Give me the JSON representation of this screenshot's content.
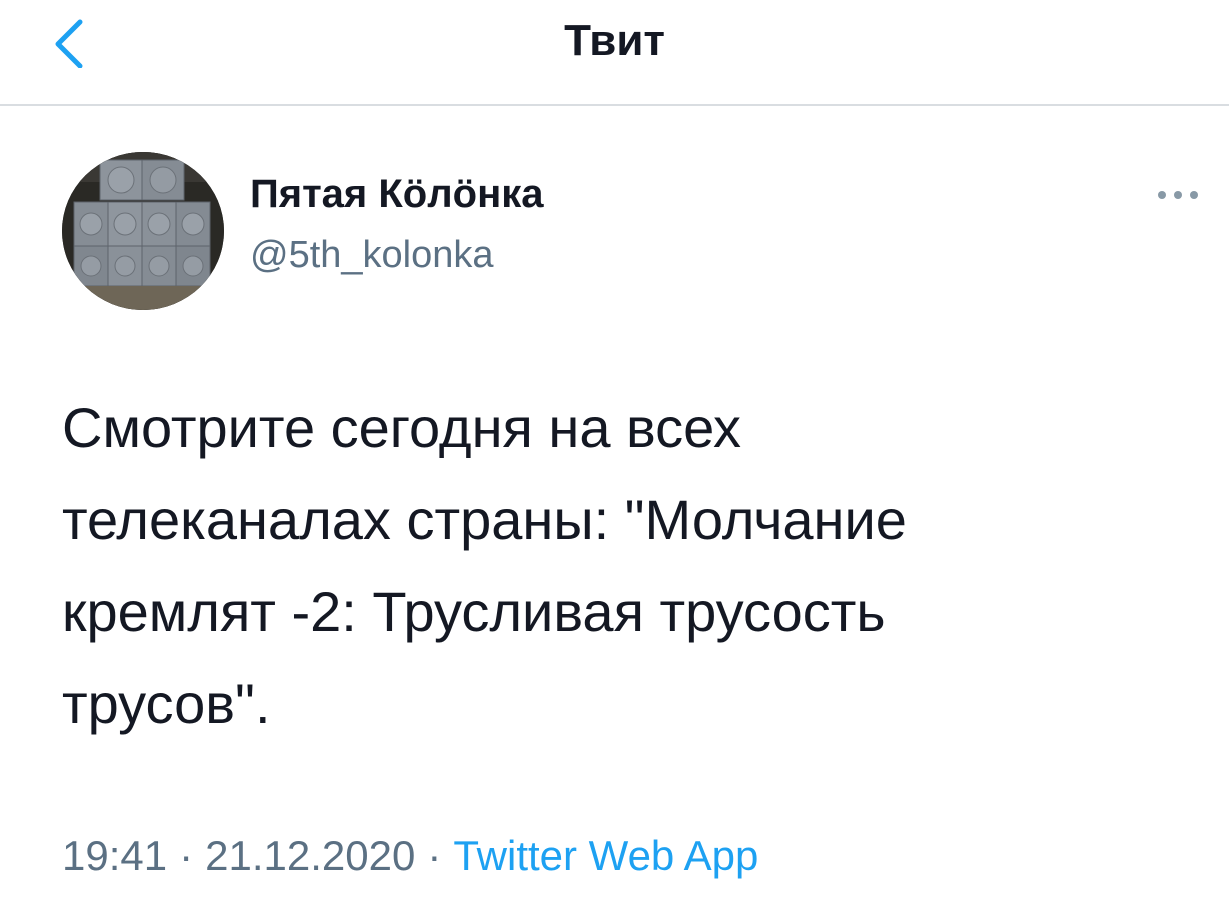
{
  "nav": {
    "title": "Твит",
    "back_icon": "chevron-left-icon",
    "accent_color": "#1da1f2"
  },
  "tweet": {
    "author_name": "Пятая Кöлöнка",
    "author_handle": "@5th_kolonka",
    "avatar_icon": "speakers-avatar-image",
    "more_icon": "more-options-icon",
    "text": "Смотрите сегодня на всех\nтелеканалах страны: \"Молчание\nкремлят -2: Трусливая трусость\nтрусов\".",
    "time": "19:41",
    "separator": "·",
    "date": "21.12.2020",
    "source": "Twitter Web App"
  }
}
